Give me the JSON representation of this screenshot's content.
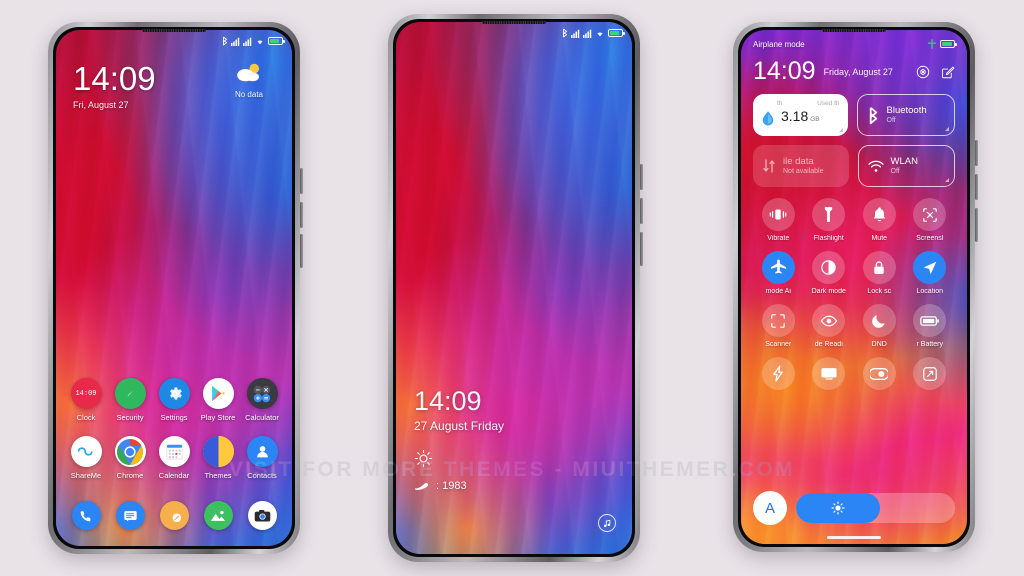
{
  "background_color": "#e9e3e8",
  "watermark": "VISIT FOR MORE THEMES - MIUITHEMER.COM",
  "phone1": {
    "name": "home-screen-phone",
    "status_bar": {
      "icons": [
        "bluetooth-icon",
        "signal-icon",
        "signal-icon",
        "wifi-icon",
        "battery-icon"
      ]
    },
    "clock": {
      "time": "14:09",
      "date": "Fri, August 27"
    },
    "weather": {
      "icon": "partly-cloudy-icon",
      "label": "No data"
    },
    "apps_row1": [
      {
        "label": "Clock",
        "icon": "clock-icon",
        "badge": "14:09"
      },
      {
        "label": "Security",
        "icon": "security-icon"
      },
      {
        "label": "Settings",
        "icon": "gear-icon"
      },
      {
        "label": "Play Store",
        "icon": "play-store-icon"
      },
      {
        "label": "Calculator",
        "icon": "calculator-icon"
      }
    ],
    "apps_row2": [
      {
        "label": "ShareMe",
        "icon": "shareme-icon"
      },
      {
        "label": "Chrome",
        "icon": "chrome-icon"
      },
      {
        "label": "Calendar",
        "icon": "calendar-icon"
      },
      {
        "label": "Themes",
        "icon": "themes-icon"
      },
      {
        "label": "Contacts",
        "icon": "contacts-icon"
      }
    ],
    "dock": [
      {
        "label": "Phone",
        "icon": "phone-icon"
      },
      {
        "label": "Messages",
        "icon": "messages-icon"
      },
      {
        "label": "Notes",
        "icon": "notes-icon"
      },
      {
        "label": "Gallery",
        "icon": "gallery-icon"
      },
      {
        "label": "Camera",
        "icon": "camera-icon"
      }
    ]
  },
  "phone2": {
    "name": "lock-screen-phone",
    "status_bar": {
      "icons": [
        "bluetooth-icon",
        "signal-icon",
        "signal-icon",
        "wifi-icon",
        "battery-icon"
      ]
    },
    "lock": {
      "time": "14:09",
      "date": "27 August Friday",
      "weather_icon": "sun-icon",
      "steps_icon": "shoe-icon",
      "steps": ": 1983",
      "music_icon": "music-note-icon"
    }
  },
  "phone3": {
    "name": "control-center-phone",
    "status": {
      "airplane_label": "Airplane mode",
      "charge_icon": "charging-bolt-icon",
      "battery_icon": "battery-icon"
    },
    "header": {
      "time": "14:09",
      "date": "Friday, August 27",
      "settings_icon": "settings-gear-icon",
      "edit_icon": "edit-pencil-icon"
    },
    "data_card": {
      "icon": "water-drop-icon",
      "small_left": "th",
      "small_right": "Used th",
      "amount": "3.18",
      "unit": "GB"
    },
    "tiles": [
      {
        "title": "Bluetooth",
        "sub": "Off",
        "icon": "bluetooth-icon",
        "style": "outline"
      },
      {
        "title": "ile data",
        "sub": "Not available",
        "icon": "mobile-data-icon",
        "style": "dim"
      },
      {
        "title": "WLAN",
        "sub": "Off",
        "icon": "wifi-icon",
        "style": "outline"
      }
    ],
    "quick_settings": [
      {
        "label": "Vibrate",
        "icon": "vibrate-icon",
        "active": false
      },
      {
        "label": "Flashlight",
        "icon": "flashlight-icon",
        "active": false
      },
      {
        "label": "Mute",
        "icon": "bell-icon",
        "active": false
      },
      {
        "label": "Screensl",
        "icon": "screenshot-icon",
        "active": false
      },
      {
        "label": "mode    Ai",
        "icon": "airplane-icon",
        "active": true
      },
      {
        "label": "Dark mode",
        "icon": "dark-mode-icon",
        "active": false
      },
      {
        "label": "Lock sc",
        "icon": "lock-icon",
        "active": false
      },
      {
        "label": "Location",
        "icon": "location-arrow-icon",
        "active": true
      },
      {
        "label": "Scanner",
        "icon": "scanner-icon",
        "active": false
      },
      {
        "label": "de   Readi",
        "icon": "eye-icon",
        "active": false
      },
      {
        "label": "DND",
        "icon": "moon-icon",
        "active": false
      },
      {
        "label": "r    Battery",
        "icon": "battery-saver-icon",
        "active": false
      },
      {
        "label": "",
        "icon": "lightning-icon",
        "active": false
      },
      {
        "label": "",
        "icon": "cast-icon",
        "active": false
      },
      {
        "label": "",
        "icon": "color-mode-icon",
        "active": false
      },
      {
        "label": "",
        "icon": "expand-icon",
        "active": false
      }
    ],
    "brightness": {
      "auto_label": "A",
      "slider_icon": "brightness-sun-icon",
      "level_percent": 53
    }
  }
}
